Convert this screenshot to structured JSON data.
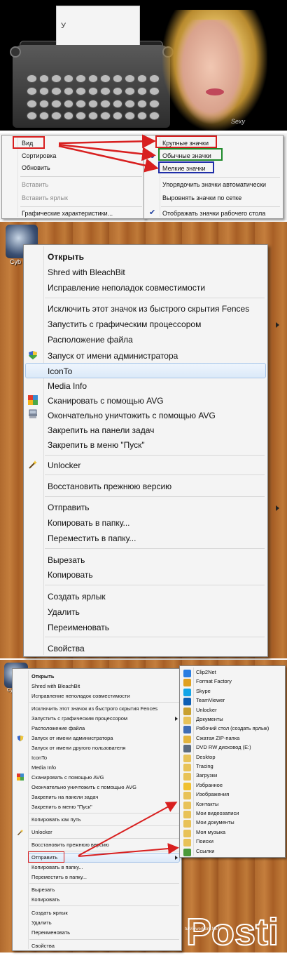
{
  "banner": {
    "paper_text": "У",
    "signature": "Sexy"
  },
  "view_menu": {
    "items": [
      {
        "label": "Вид",
        "disabled": false
      },
      {
        "label": "Сортировка",
        "disabled": false
      },
      {
        "label": "Обновить",
        "disabled": false
      },
      {
        "label": "Вставить",
        "disabled": true
      },
      {
        "label": "Вставить ярлык",
        "disabled": true
      },
      {
        "label": "Графические характеристики...",
        "disabled": false
      }
    ],
    "submenu": [
      {
        "label": "Крупные значки"
      },
      {
        "label": "Обычные значки"
      },
      {
        "label": "Мелкие значки"
      },
      {
        "label": "Упорядочить значки автоматически"
      },
      {
        "label": "Выровнять значки по сетке"
      },
      {
        "label": "Отображать значки рабочего стола"
      }
    ],
    "colors": {
      "red": "#d81f1f",
      "green": "#1f8a2a",
      "blue": "#1f2ea8"
    }
  },
  "context_menu": {
    "desktop_icon_label": "Cyb",
    "items": [
      {
        "label": "Открыть",
        "bold": true
      },
      {
        "label": "Shred with BleachBit"
      },
      {
        "label": "Исправление неполадок совместимости"
      },
      {
        "label": "Исключить этот значок из быстрого скрытия Fences"
      },
      {
        "label": "Запустить с графическим процессором",
        "submenu": true
      },
      {
        "label": "Расположение файла"
      },
      {
        "label": "Запуск от имени администратора",
        "icon": "shield-icon"
      },
      {
        "label": "IconTo",
        "highlighted": true
      },
      {
        "label": "Media Info"
      },
      {
        "label": "Сканировать с помощью AVG",
        "icon": "avg-icon"
      },
      {
        "label": "Окончательно уничтожить с помощью AVG",
        "icon": "shredder-icon"
      },
      {
        "label": "Закрепить на панели задач"
      },
      {
        "label": "Закрепить в меню \"Пуск\""
      },
      {
        "label": "Unlocker",
        "icon": "wand-icon"
      },
      {
        "label": "Восстановить прежнюю версию"
      },
      {
        "label": "Отправить",
        "submenu": true
      },
      {
        "label": "Копировать в папку..."
      },
      {
        "label": "Переместить в папку..."
      },
      {
        "label": "Вырезать"
      },
      {
        "label": "Копировать"
      },
      {
        "label": "Создать ярлык"
      },
      {
        "label": "Удалить"
      },
      {
        "label": "Переименовать"
      },
      {
        "label": "Свойства"
      }
    ]
  },
  "send_to_menu": {
    "desktop_icon_label": "Cyb",
    "items": [
      {
        "label": "Открыть",
        "bold": true
      },
      {
        "label": "Shred with BleachBit"
      },
      {
        "label": "Исправление неполадок совместимости"
      },
      {
        "label": "Исключить этот значок из быстрого скрытия Fences"
      },
      {
        "label": "Запустить с графическим процессором"
      },
      {
        "label": "Расположение файла"
      },
      {
        "label": "Запуск от имени администратора"
      },
      {
        "label": "Запуск от имени другого пользователя"
      },
      {
        "label": "IconTo"
      },
      {
        "label": "Media Info"
      },
      {
        "label": "Сканировать с помощью AVG"
      },
      {
        "label": "Окончательно уничтожить с помощью AVG"
      },
      {
        "label": "Закрепить на панели задач"
      },
      {
        "label": "Закрепить в меню \"Пуск\""
      },
      {
        "label": "Копировать как путь"
      },
      {
        "label": "Unlocker"
      },
      {
        "label": "Восстановить прежнюю версию"
      },
      {
        "label": "Отправить"
      },
      {
        "label": "Копировать в папку..."
      },
      {
        "label": "Переместить в папку..."
      },
      {
        "label": "Вырезать"
      },
      {
        "label": "Копировать"
      },
      {
        "label": "Создать ярлык"
      },
      {
        "label": "Удалить"
      },
      {
        "label": "Переименовать"
      },
      {
        "label": "Свойства"
      }
    ],
    "targets": [
      {
        "label": "Clip2Net",
        "color": "#2a7de1"
      },
      {
        "label": "Format Factory",
        "color": "#e0a020"
      },
      {
        "label": "Skype",
        "color": "#12a5e8"
      },
      {
        "label": "TeamViewer",
        "color": "#0e5fb4"
      },
      {
        "label": "Unlocker",
        "color": "#c8a030"
      },
      {
        "label": "Документы",
        "color": "#e8c258"
      },
      {
        "label": "Рабочий стол (создать ярлык)",
        "color": "#3f6db5"
      },
      {
        "label": "Сжатая ZIP-папка",
        "color": "#e3b43d"
      },
      {
        "label": "DVD RW дисковод (E:)",
        "color": "#5c6c80"
      },
      {
        "label": "Desktop",
        "color": "#e8c258"
      },
      {
        "label": "Tracing",
        "color": "#e8c258"
      },
      {
        "label": "Загрузки",
        "color": "#e8c258"
      },
      {
        "label": "Избранное",
        "color": "#f0c030"
      },
      {
        "label": "Изображения",
        "color": "#e8c258"
      },
      {
        "label": "Контакты",
        "color": "#e8c258"
      },
      {
        "label": "Мои видеозаписи",
        "color": "#e8c258"
      },
      {
        "label": "Мои документы",
        "color": "#e8c258"
      },
      {
        "label": "Моя музыка",
        "color": "#e8c258"
      },
      {
        "label": "Поиски",
        "color": "#e8c258"
      },
      {
        "label": "Ссылки",
        "color": "#4a9a3a"
      }
    ],
    "watermark": "Posti",
    "footer_text": "tu.ViewerFont.NET"
  }
}
